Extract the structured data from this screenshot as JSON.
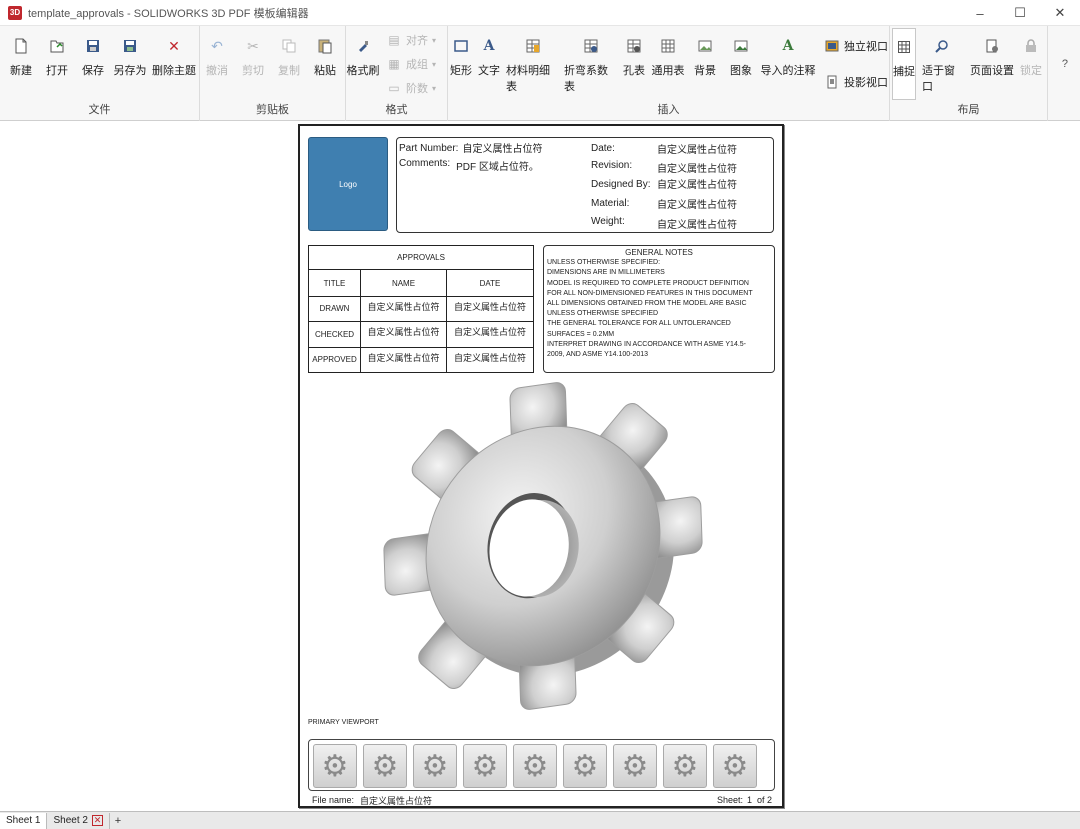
{
  "window": {
    "title": "template_approvals - SOLIDWORKS 3D PDF 模板编辑器",
    "app_icon_text": "3D"
  },
  "ribbon": {
    "groups": {
      "file": "文件",
      "clipboard": "剪贴板",
      "format": "格式",
      "insert": "插入",
      "layout": "布局"
    },
    "file_buttons": {
      "new": "新建",
      "open": "打开",
      "save": "保存",
      "save_as": "另存为",
      "delete_theme": "删除主题"
    },
    "clipboard_buttons": {
      "undo": "撤消",
      "cut": "剪切",
      "copy": "复制",
      "paste": "粘贴"
    },
    "format_buttons": {
      "format_painter": "格式刷",
      "align": "对齐",
      "group": "成组",
      "order": "阶数"
    },
    "insert_buttons": {
      "rectangle": "矩形",
      "text": "文字",
      "bom": "材料明细表",
      "bend_table": "折弯系数表",
      "hole_table": "孔表",
      "general_table": "通用表",
      "background": "背景",
      "image": "图象",
      "import_annotations": "导入的注释",
      "standalone_viewport": "独立视口",
      "projected_viewport": "投影视口"
    },
    "layout_buttons": {
      "snap": "捕捉",
      "fit_window": "适于窗口",
      "page_setup": "页面设置",
      "lock": "锁定"
    },
    "help": "?"
  },
  "sheet": {
    "logo_text": "Logo",
    "part_number_label": "Part Number:",
    "part_number_value": "自定义属性占位符",
    "comments_label": "Comments:",
    "comments_value": "PDF 区域占位符。",
    "date_label": "Date:",
    "date_value": "自定义属性占位符",
    "revision_label": "Revision:",
    "revision_value": "自定义属性占位符",
    "designed_by_label": "Designed By:",
    "designed_by_value": "自定义属性占位符",
    "material_label": "Material:",
    "material_value": "自定义属性占位符",
    "weight_label": "Weight:",
    "weight_value": "自定义属性占位符",
    "approvals": {
      "title": "APPROVALS",
      "headers": [
        "TITLE",
        "NAME",
        "DATE"
      ],
      "rows": [
        {
          "title": "DRAWN",
          "name": "自定义属性占位符",
          "date": "自定义属性占位符"
        },
        {
          "title": "CHECKED",
          "name": "自定义属性占位符",
          "date": "自定义属性占位符"
        },
        {
          "title": "APPROVED",
          "name": "自定义属性占位符",
          "date": "自定义属性占位符"
        }
      ]
    },
    "general_notes": {
      "title": "GENERAL NOTES",
      "lines": [
        "UNLESS OTHERWISE SPECIFIED:",
        "DIMENSIONS ARE IN MILLIMETERS",
        "MODEL IS REQUIRED TO COMPLETE PRODUCT DEFINITION",
        "FOR ALL NON-DIMENSIONED FEATURES IN THIS DOCUMENT",
        "ALL DIMENSIONS OBTAINED FROM THE MODEL ARE BASIC",
        "UNLESS OTHERWISE SPECIFIED",
        "THE GENERAL TOLERANCE FOR ALL UNTOLERANCED",
        "SURFACES = 0.2MM",
        "INTERPRET DRAWING IN ACCORDANCE WITH ASME Y14.5-",
        "2009, AND ASME Y14.100-2013"
      ]
    },
    "primary_viewport_label": "PRIMARY VIEWPORT",
    "thumbnail_count": 9,
    "file_name_label": "File name:",
    "file_name_value": "自定义属性占位符",
    "sheet_label": "Sheet:",
    "sheet_number": "1",
    "sheet_of": "of 2"
  },
  "tabs": [
    {
      "label": "Sheet 1",
      "active": true
    },
    {
      "label": "Sheet 2",
      "active": false
    }
  ],
  "tab_add": "+",
  "colors": {
    "logo_fill": "#3f7fb0",
    "delete_red": "#c0272d",
    "ribbon_bg": "#f7f7f7"
  }
}
